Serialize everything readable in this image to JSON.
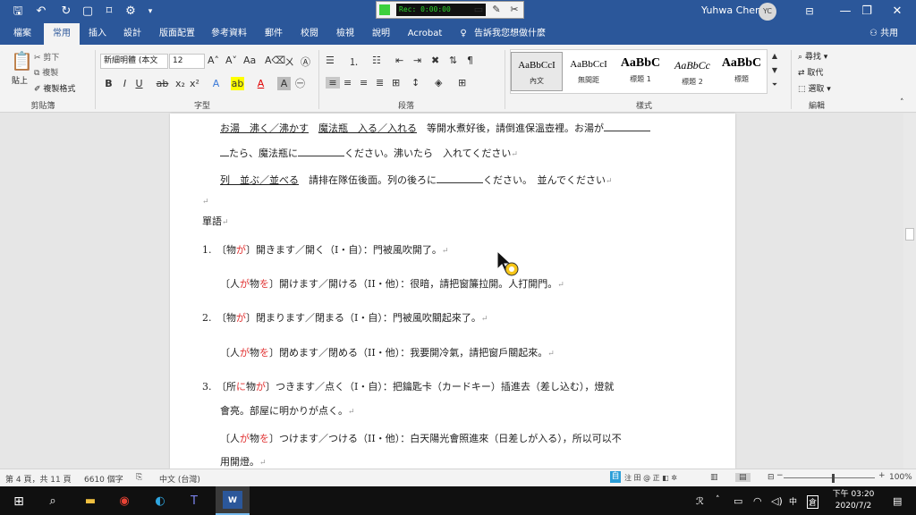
{
  "titlebar": {
    "recorder_time": "Rec: 0:00:00",
    "user_name": "Yuhwa Chen",
    "user_initials": "YC"
  },
  "tabs": [
    "檔案",
    "常用",
    "插入",
    "設計",
    "版面配置",
    "參考資料",
    "郵件",
    "校閱",
    "檢視",
    "說明",
    "Acrobat",
    "告訴我您想做什麼"
  ],
  "active_tab": "常用",
  "share_label": "共用",
  "ribbon": {
    "clipboard": {
      "paste": "貼上",
      "cut": "剪下",
      "copy": "複製",
      "format_painter": "複製格式",
      "label": "剪貼簿"
    },
    "font": {
      "name": "新細明體 (本文",
      "size": "12",
      "label": "字型"
    },
    "paragraph": {
      "label": "段落"
    },
    "styles": {
      "label": "樣式",
      "items": [
        {
          "sample": "AaBbCcI",
          "name": "內文"
        },
        {
          "sample": "AaBbCcI",
          "name": "無間距"
        },
        {
          "sample": "AaBbC",
          "name": "標題 1"
        },
        {
          "sample": "AaBbCc",
          "name": "標題 2"
        },
        {
          "sample": "AaBbC",
          "name": "標題"
        }
      ]
    },
    "editing": {
      "find": "尋找",
      "replace": "取代",
      "select": "選取",
      "label": "編輯"
    }
  },
  "document": {
    "lines": [
      {
        "a": "お湯　沸く／沸かす",
        "b": "魔法瓶　入る／入れる",
        "c": "　等開水煮好後，請倒進保溫壺裡。お湯が"
      },
      {
        "a": "たら、魔法瓶に",
        "b": "ください。沸いたら　入れてください"
      },
      {
        "a": "列　並ぶ／並べる",
        "b": "　請排在隊伍後面。列の後ろに",
        "c": "ください。　並んでください"
      },
      {
        "a": "單語"
      },
      {
        "num": "1.",
        "pre": "〔物",
        "ga": "が",
        "post": "〕開きます／開く（I・自）：門被風吹開了。"
      },
      {
        "pre": "〔人",
        "ga": "が",
        "mid": "物",
        "wo": "を",
        "post": "〕開けます／開ける（II・他）：很暗，請把窗簾拉開。人打開門。"
      },
      {
        "num": "2.",
        "pre": "〔物",
        "ga": "が",
        "post": "〕閉まります／閉まる（I・自）：門被風吹關起來了。"
      },
      {
        "pre": "〔人",
        "ga": "が",
        "mid": "物",
        "wo": "を",
        "post": "〕閉めます／閉める（II・他）：我要開冷氣，請把窗戶關起來。"
      },
      {
        "num": "3.",
        "pre": "〔所",
        "ni": "に",
        "mid": "物",
        "ga": "が",
        "post": "〕つきます／点く（I・自）：把鑰匙卡（カードキー）插進去（差し込む），燈就"
      },
      {
        "a": "會亮。部屋に明かりが点く。"
      },
      {
        "pre": "〔人",
        "ga": "が",
        "mid": "物",
        "wo": "を",
        "post": "〕つけます／つける（II・他）：白天陽光會照進來（日差しが入る），所以可以不"
      },
      {
        "a": "用開燈。"
      }
    ]
  },
  "statusbar": {
    "page": "第 4 頁，共 11 頁",
    "words": "6610 個字",
    "language": "中文 (台灣)",
    "zoom": "100%"
  },
  "taskbar": {
    "time": "下午 03:20",
    "date": "2020/7/2"
  }
}
